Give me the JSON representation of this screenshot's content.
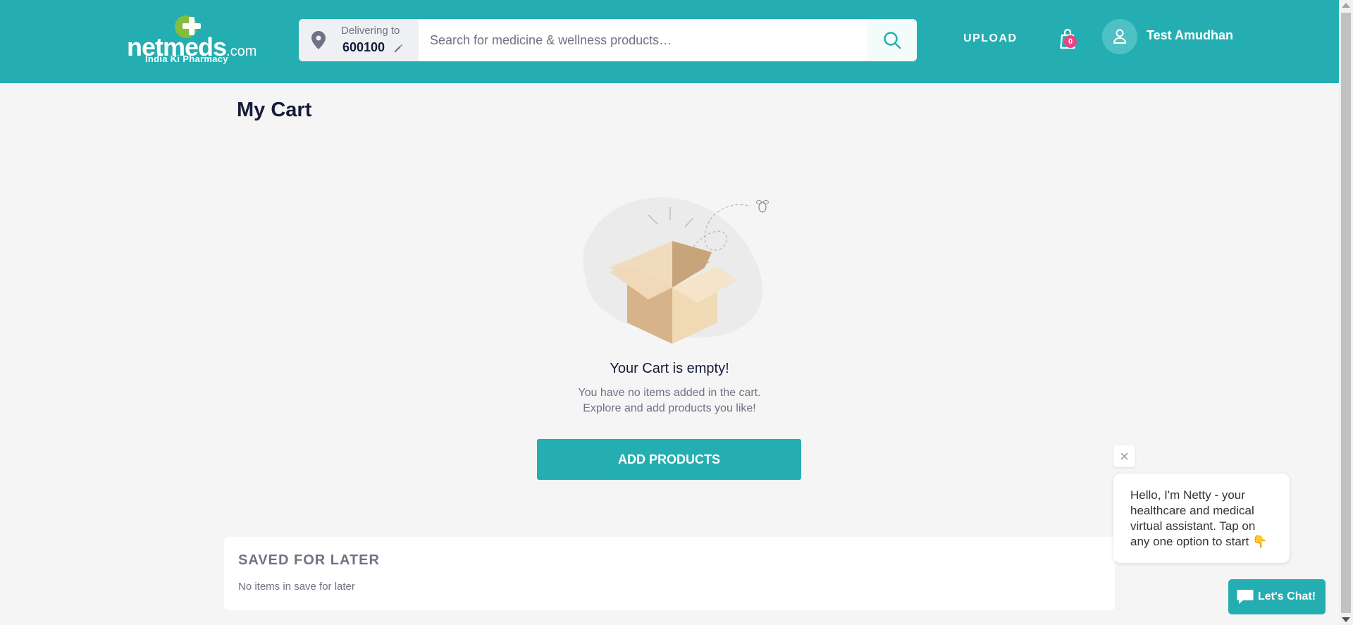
{
  "header": {
    "logo": {
      "wordmark": "netmeds",
      "suffix": ".com",
      "tagline": "India Ki Pharmacy"
    },
    "delivery": {
      "label": "Delivering to",
      "pincode": "600100"
    },
    "search": {
      "placeholder": "Search for medicine & wellness products…"
    },
    "upload_label": "UPLOAD",
    "cart_count": "0",
    "user_name": "Test Amudhan"
  },
  "page": {
    "title": "My Cart",
    "empty_title": "Your Cart is empty!",
    "empty_line1": "You have no items added in the cart.",
    "empty_line2": "Explore and add products you like!",
    "add_button": "ADD PRODUCTS"
  },
  "saved": {
    "title": "SAVED FOR LATER",
    "empty": "No items in save for later"
  },
  "chat": {
    "close": "×",
    "message": "Hello, I'm Netty - your healthcare and medical virtual assistant. Tap on any one option to start 👇",
    "button": "Let's Chat!"
  },
  "colors": {
    "brand": "#24aeb1",
    "badge": "#ef4281",
    "text": "#151b39",
    "muted": "#6f7284"
  }
}
